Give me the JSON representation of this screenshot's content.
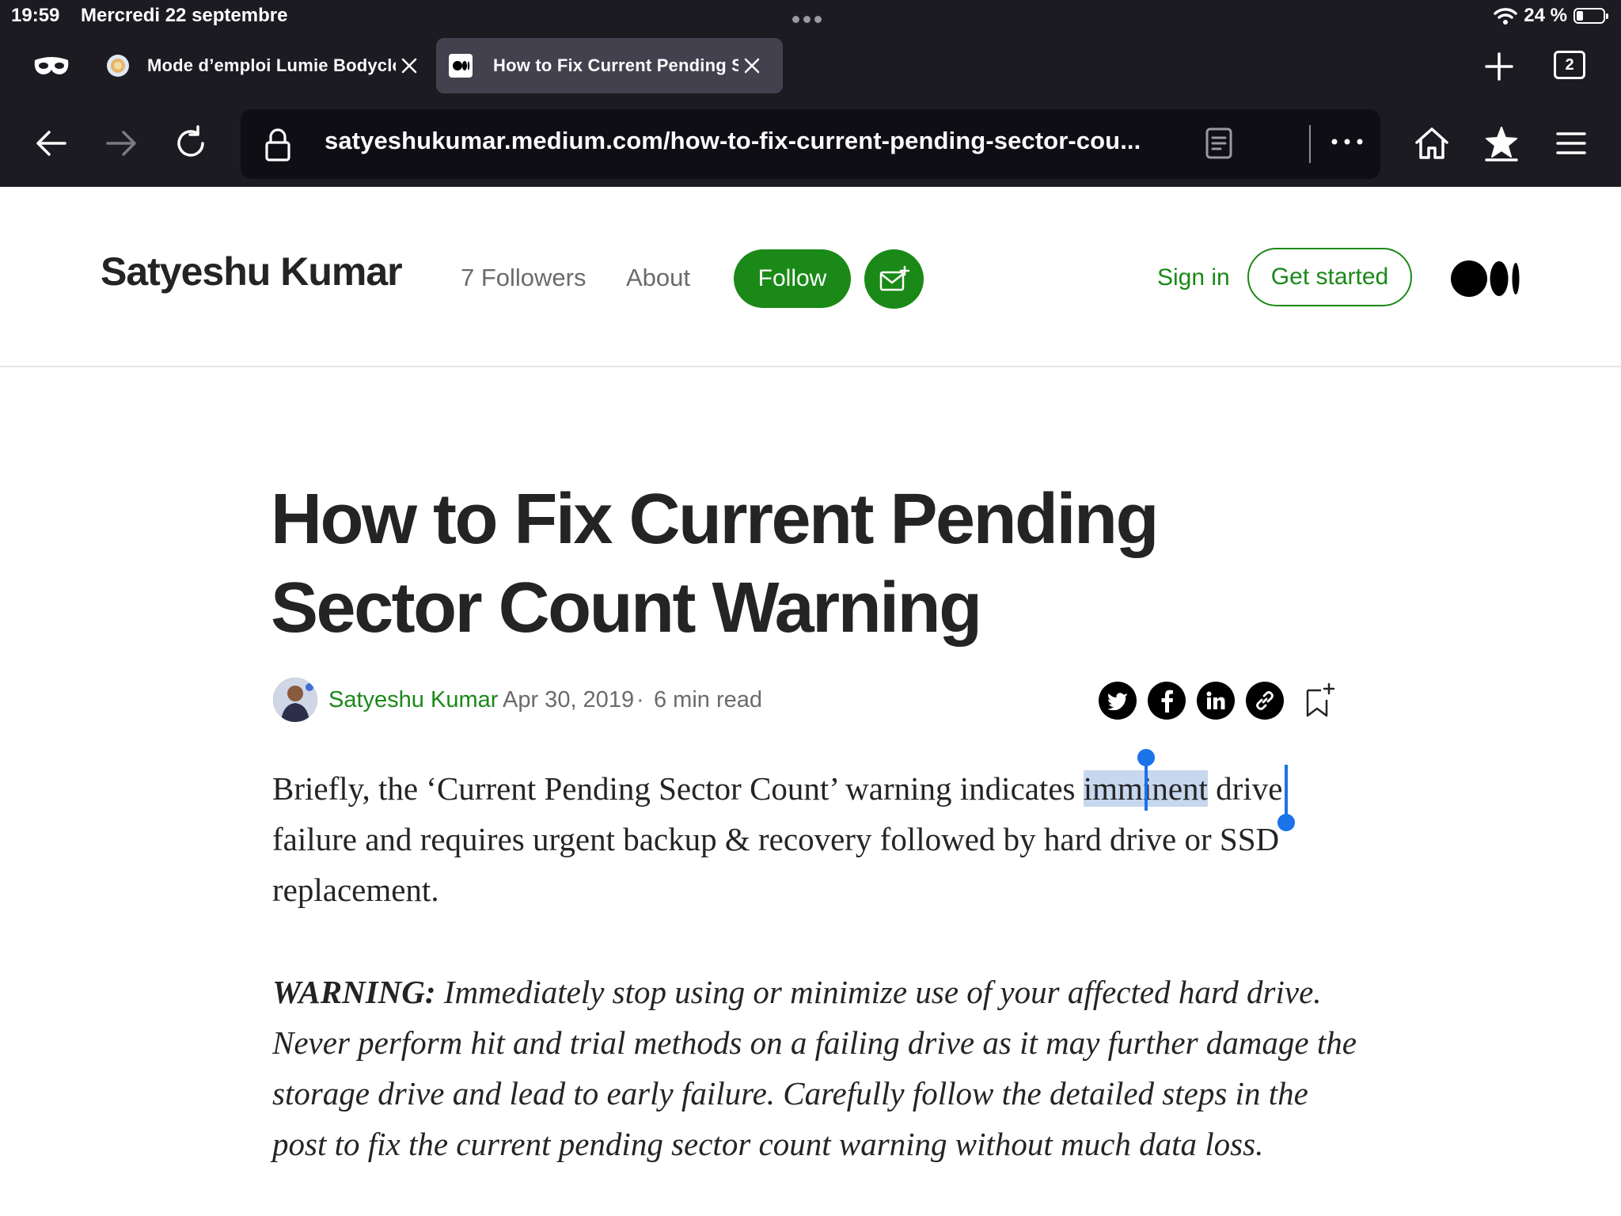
{
  "status": {
    "time": "19:59",
    "date": "Mercredi 22 septembre",
    "battery": "24 %",
    "battery_level": 0.24
  },
  "tabs": [
    {
      "title": "Mode d’emploi Lumie Bodyclock",
      "active": false,
      "icon": "lumie-favicon"
    },
    {
      "title": "How to Fix Current Pending Sector",
      "active": true,
      "icon": "medium-favicon"
    }
  ],
  "tab_count": "2",
  "toolbar": {
    "url": "satyeshukumar.medium.com/how-to-fix-current-pending-sector-cou..."
  },
  "site": {
    "author": "Satyeshu Kumar",
    "followers": "7 Followers",
    "about": "About",
    "follow": "Follow",
    "sign_in": "Sign in",
    "get_started": "Get started",
    "accent_color": "#1a8917"
  },
  "article": {
    "title": "How to Fix Current Pending Sector Count Warning",
    "byline": {
      "author": "Satyeshu Kumar",
      "date": "Apr 30, 2019",
      "separator": "·",
      "read_time": "6 min read"
    },
    "p1_before": "Briefly, the ‘Current Pending Sector Count’ warning indicates ",
    "p1_selected": "imminent",
    "p1_after": " drive failure and requires urgent backup & recovery followed by hard drive or SSD replacement.",
    "warning_label": "WARNING:",
    "warning_text": " Immediately stop using or minimize use of your affected hard drive. Never perform hit and trial methods on a failing drive as it may further damage the storage drive and lead to early failure. Carefully follow the detailed steps in the post to fix the current pending sector count warning without much data loss."
  }
}
